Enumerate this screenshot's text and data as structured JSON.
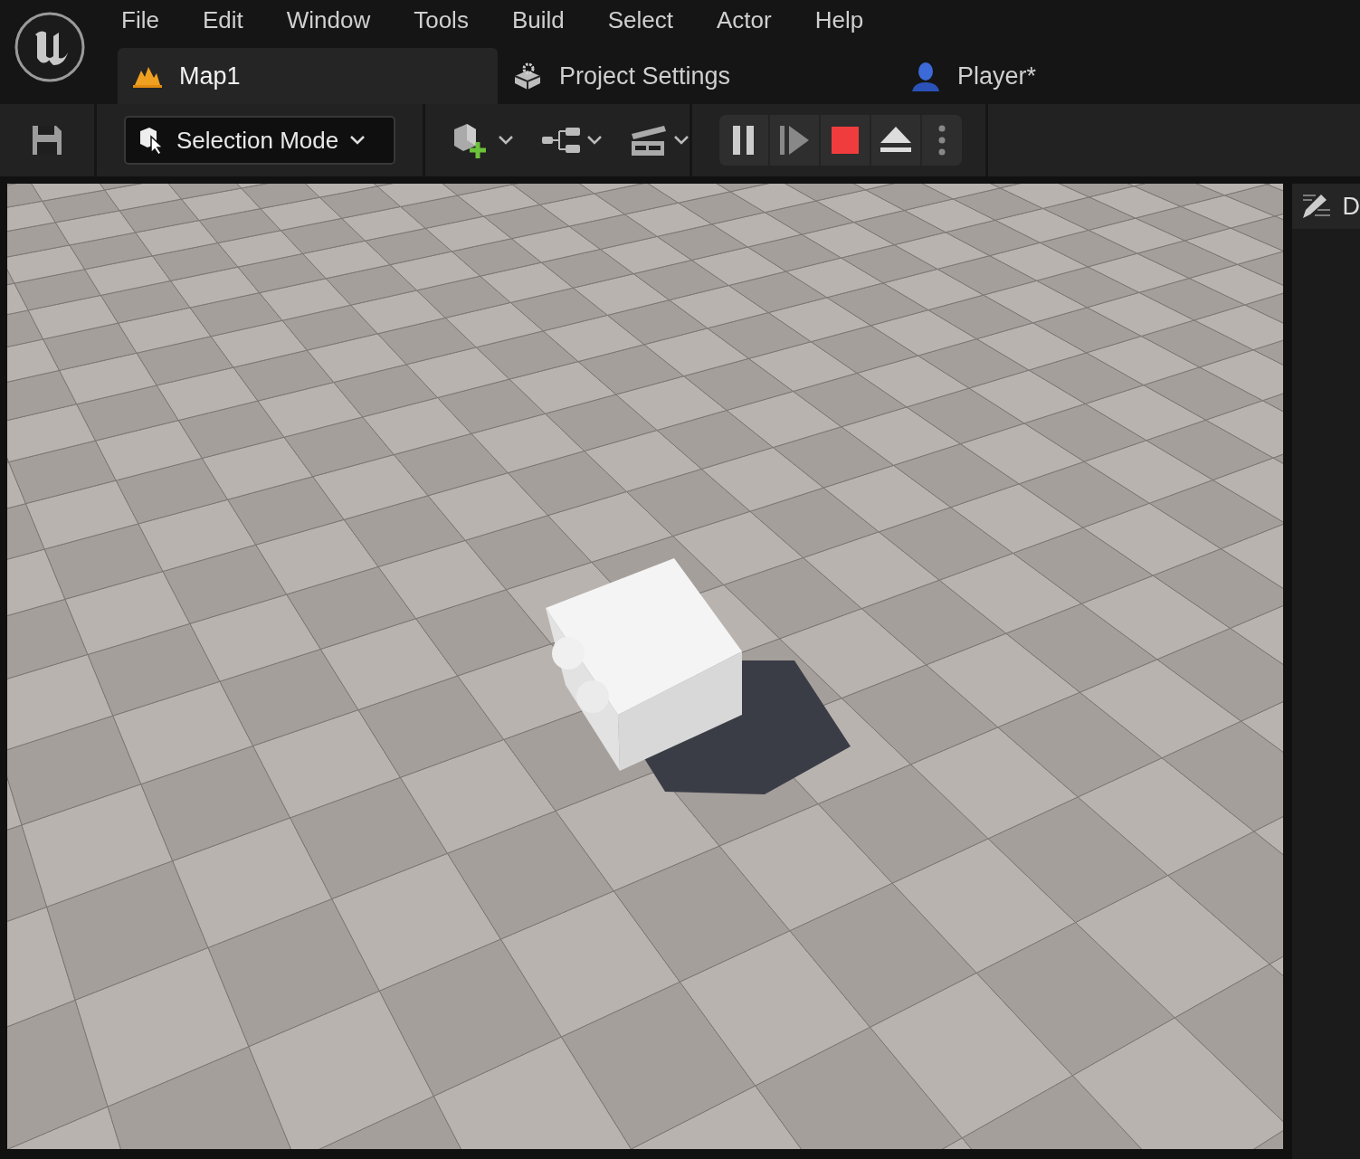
{
  "menu": [
    "File",
    "Edit",
    "Window",
    "Tools",
    "Build",
    "Select",
    "Actor",
    "Help"
  ],
  "tabs": [
    {
      "label": "Map1",
      "selected": true,
      "kind": "level"
    },
    {
      "label": "Project Settings",
      "selected": false,
      "kind": "settings"
    },
    {
      "label": "Player*",
      "selected": false,
      "kind": "blueprint"
    }
  ],
  "toolbar": {
    "mode_label": "Selection Mode"
  },
  "details_tab": {
    "label": "D"
  }
}
